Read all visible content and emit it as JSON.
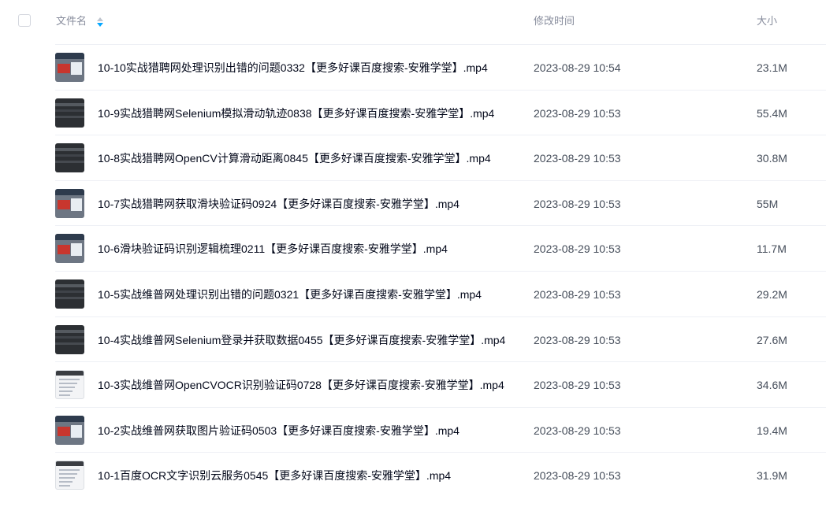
{
  "header": {
    "name_label": "文件名",
    "time_label": "修改时间",
    "size_label": "大小"
  },
  "files": [
    {
      "name": "10-10实战猎聘网处理识别出错的问题0332【更多好课百度搜索-安雅学堂】.mp4",
      "time": "2023-08-29 10:54",
      "size": "23.1M",
      "thumb": "img"
    },
    {
      "name": "10-9实战猎聘网Selenium模拟滑动轨迹0838【更多好课百度搜索-安雅学堂】.mp4",
      "time": "2023-08-29 10:53",
      "size": "55.4M",
      "thumb": "dark"
    },
    {
      "name": "10-8实战猎聘网OpenCV计算滑动距离0845【更多好课百度搜索-安雅学堂】.mp4",
      "time": "2023-08-29 10:53",
      "size": "30.8M",
      "thumb": "dark"
    },
    {
      "name": "10-7实战猎聘网获取滑块验证码0924【更多好课百度搜索-安雅学堂】.mp4",
      "time": "2023-08-29 10:53",
      "size": "55M",
      "thumb": "img"
    },
    {
      "name": "10-6滑块验证码识别逻辑梳理0211【更多好课百度搜索-安雅学堂】.mp4",
      "time": "2023-08-29 10:53",
      "size": "11.7M",
      "thumb": "img"
    },
    {
      "name": "10-5实战维普网处理识别出错的问题0321【更多好课百度搜索-安雅学堂】.mp4",
      "time": "2023-08-29 10:53",
      "size": "29.2M",
      "thumb": "dark"
    },
    {
      "name": "10-4实战维普网Selenium登录并获取数据0455【更多好课百度搜索-安雅学堂】.mp4",
      "time": "2023-08-29 10:53",
      "size": "27.6M",
      "thumb": "dark"
    },
    {
      "name": "10-3实战维普网OpenCVOCR识别验证码0728【更多好课百度搜索-安雅学堂】.mp4",
      "time": "2023-08-29 10:53",
      "size": "34.6M",
      "thumb": "doc"
    },
    {
      "name": "10-2实战维普网获取图片验证码0503【更多好课百度搜索-安雅学堂】.mp4",
      "time": "2023-08-29 10:53",
      "size": "19.4M",
      "thumb": "img"
    },
    {
      "name": "10-1百度OCR文字识别云服务0545【更多好课百度搜索-安雅学堂】.mp4",
      "time": "2023-08-29 10:53",
      "size": "31.9M",
      "thumb": "doc"
    }
  ],
  "colors": {
    "sort_icon_up": "#bfc5cf",
    "sort_icon_down": "#06a7ff"
  },
  "icons": {
    "sort": "sort-icon",
    "checkbox": "select-all-checkbox"
  }
}
